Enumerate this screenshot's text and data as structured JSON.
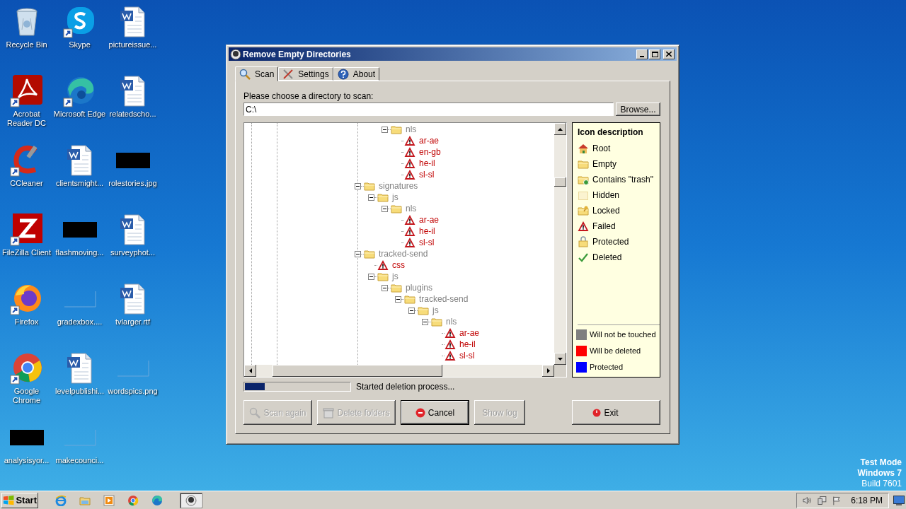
{
  "desktop_icons": [
    {
      "label": "Recycle Bin",
      "kind": "recycle",
      "shortcut": false
    },
    {
      "label": "Acrobat Reader DC",
      "kind": "acrobat",
      "shortcut": true
    },
    {
      "label": "CCleaner",
      "kind": "ccleaner",
      "shortcut": true
    },
    {
      "label": "FileZilla Client",
      "kind": "filezilla",
      "shortcut": true
    },
    {
      "label": "Firefox",
      "kind": "firefox",
      "shortcut": true
    },
    {
      "label": "Google Chrome",
      "kind": "chrome",
      "shortcut": true
    },
    {
      "label": "analysisyor...",
      "kind": "black",
      "shortcut": false
    },
    {
      "label": "Skype",
      "kind": "skype",
      "shortcut": true
    },
    {
      "label": "Microsoft Edge",
      "kind": "edge",
      "shortcut": true
    },
    {
      "label": "clientsmight...",
      "kind": "word",
      "shortcut": false
    },
    {
      "label": "flashmoving...",
      "kind": "black",
      "shortcut": false
    },
    {
      "label": "gradexbox....",
      "kind": "blank",
      "shortcut": false
    },
    {
      "label": "levelpublishi...",
      "kind": "word",
      "shortcut": false
    },
    {
      "label": "makecounci...",
      "kind": "blank",
      "shortcut": false
    },
    {
      "label": "pictureissue...",
      "kind": "word",
      "shortcut": false
    },
    {
      "label": "relatedscho...",
      "kind": "word",
      "shortcut": false
    },
    {
      "label": "rolestories.jpg",
      "kind": "black",
      "shortcut": false
    },
    {
      "label": "surveyphot...",
      "kind": "word",
      "shortcut": false
    },
    {
      "label": "tvlarger.rtf",
      "kind": "word",
      "shortcut": false
    },
    {
      "label": "wordspics.png",
      "kind": "blank",
      "shortcut": false
    }
  ],
  "window": {
    "title": "Remove Empty Directories"
  },
  "tabs": [
    {
      "label": "Scan",
      "kind": "scan",
      "selected": true
    },
    {
      "label": "Settings",
      "kind": "settings",
      "selected": false
    },
    {
      "label": "About",
      "kind": "about",
      "selected": false
    }
  ],
  "directory": {
    "label": "Please choose a directory to scan:",
    "value": "C:\\",
    "browse_button": "Browse..."
  },
  "tree": {
    "continued_branch": [
      {
        "name": "nls",
        "kind": "folder",
        "expanded": true,
        "children": [
          {
            "name": "ar-ae",
            "kind": "failed"
          },
          {
            "name": "en-gb",
            "kind": "failed"
          },
          {
            "name": "he-il",
            "kind": "failed"
          },
          {
            "name": "sl-sl",
            "kind": "failed"
          }
        ]
      }
    ],
    "items": [
      {
        "name": "signatures",
        "kind": "folder",
        "expanded": true,
        "children": [
          {
            "name": "js",
            "kind": "folder",
            "expanded": true,
            "children": [
              {
                "name": "nls",
                "kind": "folder",
                "expanded": true,
                "children": [
                  {
                    "name": "ar-ae",
                    "kind": "failed"
                  },
                  {
                    "name": "he-il",
                    "kind": "failed"
                  },
                  {
                    "name": "sl-sl",
                    "kind": "failed"
                  }
                ]
              }
            ]
          }
        ]
      },
      {
        "name": "tracked-send",
        "kind": "folder",
        "expanded": true,
        "children": [
          {
            "name": "css",
            "kind": "failed"
          },
          {
            "name": "js",
            "kind": "folder",
            "expanded": true,
            "children": [
              {
                "name": "plugins",
                "kind": "folder",
                "expanded": true,
                "children": [
                  {
                    "name": "tracked-send",
                    "kind": "folder",
                    "expanded": true,
                    "children": [
                      {
                        "name": "js",
                        "kind": "folder",
                        "expanded": true,
                        "children": [
                          {
                            "name": "nls",
                            "kind": "folder",
                            "expanded": true,
                            "children": [
                              {
                                "name": "ar-ae",
                                "kind": "failed"
                              },
                              {
                                "name": "he-il",
                                "kind": "failed"
                              },
                              {
                                "name": "sl-sl",
                                "kind": "failed"
                              }
                            ]
                          }
                        ]
                      }
                    ]
                  }
                ]
              }
            ]
          }
        ]
      }
    ]
  },
  "legend": {
    "title": "Icon description",
    "icons": [
      {
        "label": "Root",
        "kind": "root"
      },
      {
        "label": "Empty",
        "kind": "empty"
      },
      {
        "label": "Contains \"trash\"",
        "kind": "trash"
      },
      {
        "label": "Hidden",
        "kind": "hidden"
      },
      {
        "label": "Locked",
        "kind": "locked"
      },
      {
        "label": "Failed",
        "kind": "failed"
      },
      {
        "label": "Protected",
        "kind": "protected"
      },
      {
        "label": "Deleted",
        "kind": "deleted"
      }
    ],
    "colors": [
      {
        "label": "Will not be touched",
        "color": "#808080"
      },
      {
        "label": "Will be deleted",
        "color": "#ff0000"
      },
      {
        "label": "Protected",
        "color": "#0000ff"
      }
    ]
  },
  "progress": {
    "level": 0.19,
    "status": "Started deletion process..."
  },
  "buttons": [
    {
      "label": "Scan again",
      "kind": "scan",
      "disabled": true,
      "default": false
    },
    {
      "label": "Delete folders",
      "kind": "delete",
      "disabled": true,
      "default": false
    },
    {
      "label": "Cancel",
      "kind": "cancel",
      "disabled": false,
      "default": true
    },
    {
      "label": "Show log",
      "kind": "log",
      "disabled": true,
      "default": false
    }
  ],
  "exit_button": {
    "label": "Exit"
  },
  "taskbar": {
    "start": "Start",
    "apps": [
      {
        "kind": "ie",
        "active": false
      },
      {
        "kind": "explorer",
        "active": false
      },
      {
        "kind": "media",
        "active": false
      },
      {
        "kind": "chrome",
        "active": false
      },
      {
        "kind": "edge",
        "active": false
      },
      {
        "kind": "window",
        "active": true
      }
    ],
    "clock": "6:18 PM"
  },
  "test_mode": [
    "Test Mode",
    "Windows 7",
    "Build 7601"
  ]
}
